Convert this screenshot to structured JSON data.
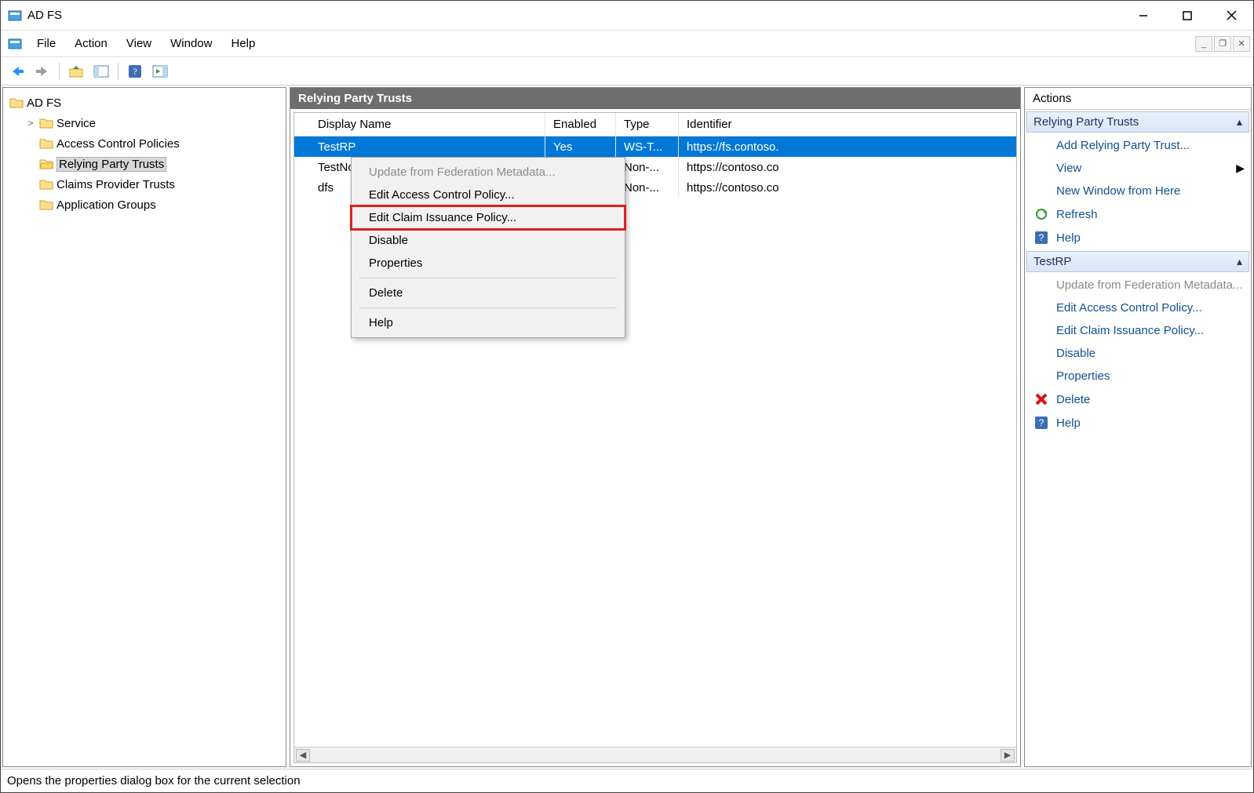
{
  "window": {
    "title": "AD FS"
  },
  "menu": {
    "items": [
      "File",
      "Action",
      "View",
      "Window",
      "Help"
    ]
  },
  "toolbar": {
    "back": "back-icon",
    "forward": "forward-icon",
    "up": "up-folder-icon",
    "props": "properties-icon",
    "help": "help-icon",
    "run": "run-icon"
  },
  "tree": {
    "root": "AD FS",
    "root_expander": ">",
    "children": [
      {
        "label": "Service",
        "selected": false
      },
      {
        "label": "Access Control Policies",
        "selected": false
      },
      {
        "label": "Relying Party Trusts",
        "selected": true
      },
      {
        "label": "Claims Provider Trusts",
        "selected": false
      },
      {
        "label": "Application Groups",
        "selected": false
      }
    ]
  },
  "center": {
    "title": "Relying Party Trusts",
    "columns": [
      "Display Name",
      "Enabled",
      "Type",
      "Identifier"
    ],
    "rows": [
      {
        "name": "TestRP",
        "enabled": "Yes",
        "type": "WS-T...",
        "ident": "https://fs.contoso.",
        "selected": true
      },
      {
        "name": "TestNon",
        "enabled": "",
        "type": "Non-...",
        "ident": "https://contoso.co",
        "selected": false
      },
      {
        "name": "dfs",
        "enabled": "",
        "type": "Non-...",
        "ident": "https://contoso.co",
        "selected": false
      }
    ]
  },
  "context_menu": {
    "items": [
      {
        "label": "Update from Federation Metadata...",
        "disabled": true,
        "highlighted": false
      },
      {
        "label": "Edit Access Control Policy...",
        "disabled": false,
        "highlighted": false
      },
      {
        "label": "Edit Claim Issuance Policy...",
        "disabled": false,
        "highlighted": true
      },
      {
        "label": "Disable",
        "disabled": false,
        "highlighted": false
      },
      {
        "label": "Properties",
        "disabled": false,
        "highlighted": false
      },
      {
        "sep": true
      },
      {
        "label": "Delete",
        "disabled": false,
        "highlighted": false
      },
      {
        "sep": true
      },
      {
        "label": "Help",
        "disabled": false,
        "highlighted": false
      }
    ]
  },
  "actions": {
    "title": "Actions",
    "sections": [
      {
        "header": "Relying Party Trusts",
        "items": [
          {
            "label": "Add Relying Party Trust...",
            "icon": "none"
          },
          {
            "label": "View",
            "icon": "none",
            "submenu": true
          },
          {
            "label": "New Window from Here",
            "icon": "none"
          },
          {
            "label": "Refresh",
            "icon": "refresh"
          },
          {
            "label": "Help",
            "icon": "help"
          }
        ]
      },
      {
        "header": "TestRP",
        "items": [
          {
            "label": "Update from Federation Metadata...",
            "icon": "none",
            "disabled": true
          },
          {
            "label": "Edit Access Control Policy...",
            "icon": "none"
          },
          {
            "label": "Edit Claim Issuance Policy...",
            "icon": "none"
          },
          {
            "label": "Disable",
            "icon": "none"
          },
          {
            "label": "Properties",
            "icon": "none"
          },
          {
            "label": "Delete",
            "icon": "delete"
          },
          {
            "label": "Help",
            "icon": "help"
          }
        ]
      }
    ]
  },
  "statusbar": {
    "text": "Opens the properties dialog box for the current selection"
  }
}
